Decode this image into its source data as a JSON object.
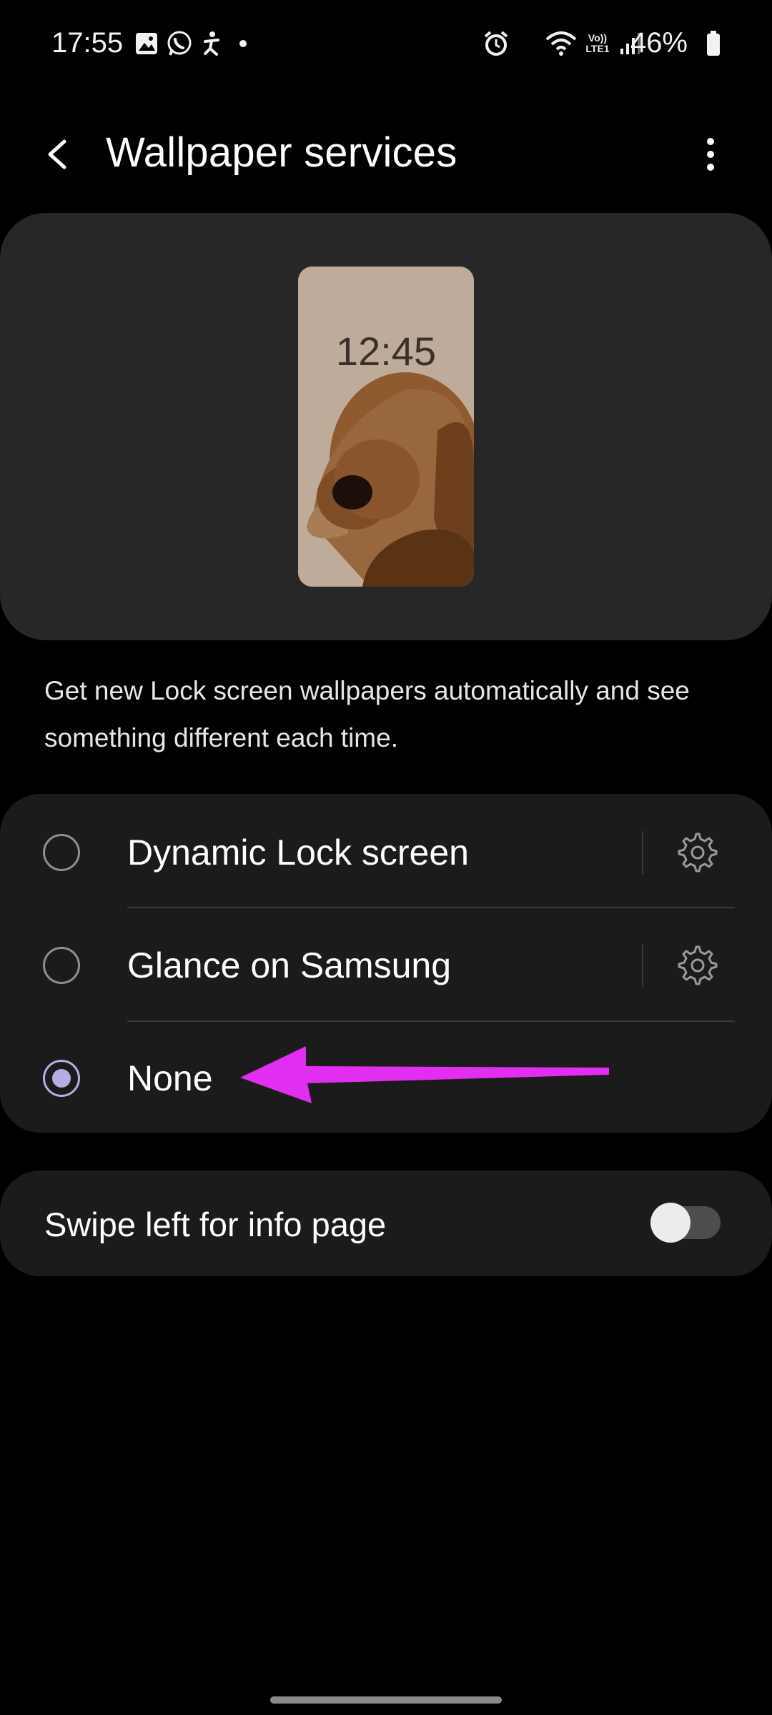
{
  "status_bar": {
    "time": "17:55",
    "left_icons": [
      "gallery-icon",
      "whatsapp-icon",
      "accessibility-icon",
      "dot-icon"
    ],
    "right_icons": [
      "alarm-icon",
      "wifi-icon",
      "volte-icon",
      "signal-icon",
      "battery-icon"
    ],
    "volte_label": "Vo))\nLTE1",
    "battery_percent": "46%"
  },
  "header": {
    "title": "Wallpaper services",
    "back_icon": "chevron-left-icon",
    "more_icon": "more-vertical-icon"
  },
  "preview": {
    "lock_time": "12:45",
    "background_color": "#bfab9a"
  },
  "description": "Get new Lock screen wallpapers automatically and see something different each time.",
  "options": [
    {
      "label": "Dynamic Lock screen",
      "selected": false,
      "has_settings": true
    },
    {
      "label": "Glance on Samsung",
      "selected": false,
      "has_settings": true
    },
    {
      "label": "None",
      "selected": true,
      "has_settings": false
    }
  ],
  "swipe_toggle": {
    "label": "Swipe left for info page",
    "enabled": false
  },
  "colors": {
    "accent_radio": "#b6aee3",
    "annotation_arrow": "#e22ef0",
    "card_background": "#1b1b1b"
  }
}
